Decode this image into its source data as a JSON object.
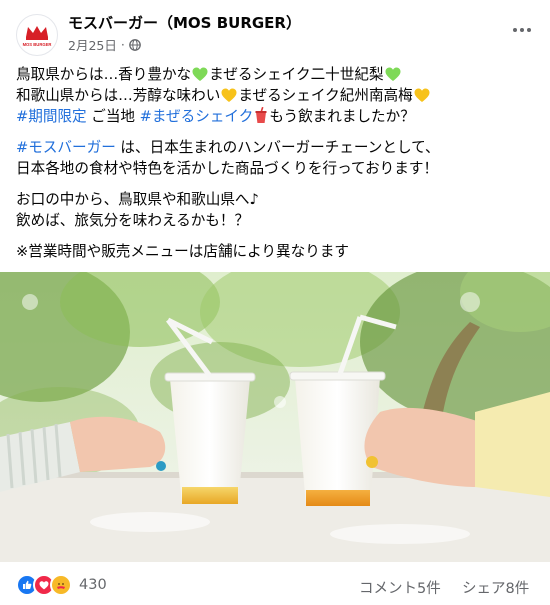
{
  "header": {
    "page_name": "モスバーガー（MOS BURGER）",
    "date": "2月25日",
    "separator": "·",
    "avatar_logo_text": "MOS BURGER"
  },
  "post": {
    "line1": {
      "a": "鳥取県からは…香り豊かな",
      "b": "まぜるシェイク二十世紀梨"
    },
    "line2": {
      "a": "和歌山県からは…芳醇な味わい",
      "b": "まぜるシェイク紀州南高梅"
    },
    "line3": {
      "tag1": "#期間限定",
      "a": " ご当地 ",
      "tag2": "#まぜるシェイク",
      "b": "もう飲まれましたか？"
    },
    "line4": {
      "tag": "#モスバーガー",
      "a": " は、日本生まれのハンバーガーチェーンとして、"
    },
    "line5": "日本各地の食材や特色を活かした商品づくりを行っております！",
    "line6": "お口の中から、鳥取県や和歌山県へ♪",
    "line7": "飲めば、旅気分を味わえるかも！？",
    "line8": "※営業時間や販売メニューは店舗により異なります"
  },
  "footer": {
    "reaction_count": "430",
    "comments": "コメント5件",
    "shares": "シェア8件"
  },
  "icons": {
    "green_heart": "green-heart-icon",
    "yellow_heart": "yellow-heart-icon",
    "cup": "cup-with-straw-icon",
    "like": "like-icon",
    "love": "love-icon",
    "care": "care-icon",
    "globe": "globe-icon",
    "more": "more-options-icon"
  },
  "colors": {
    "brand_red": "#d71f27",
    "hashtag": "#216fdb",
    "secondary_text": "#65676b",
    "green_heart": "#7ed957",
    "yellow_heart": "#f7c21a"
  }
}
